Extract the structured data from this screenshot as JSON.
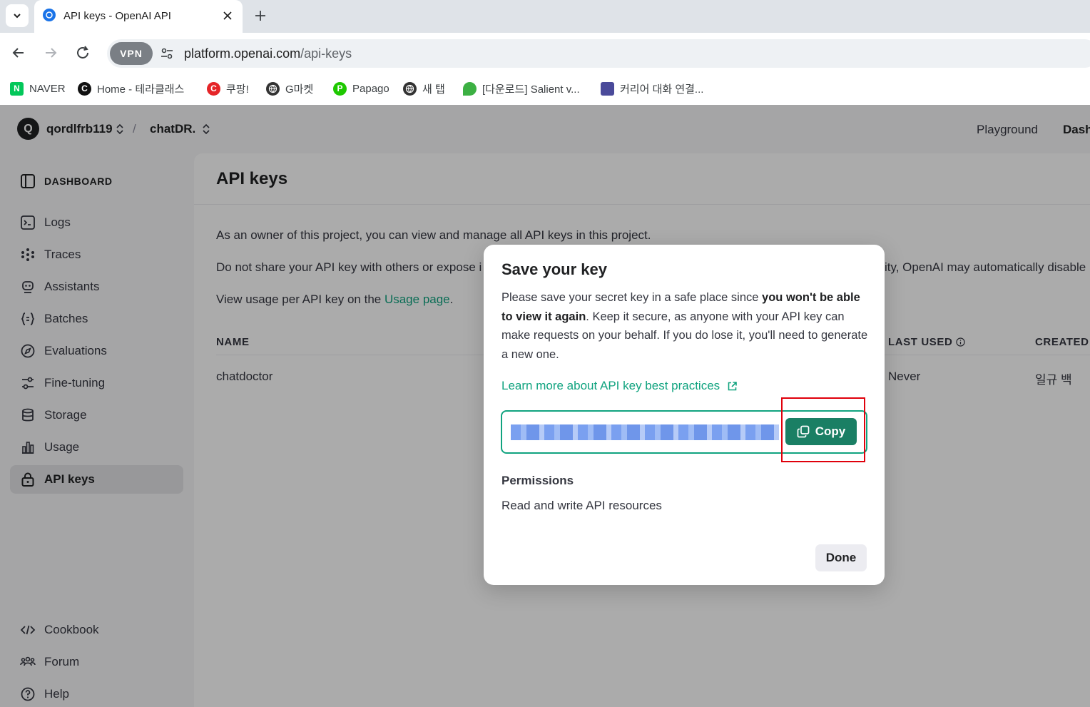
{
  "browser": {
    "tab_title": "API keys - OpenAI API",
    "vpn_label": "VPN",
    "url_host": "platform.openai.com",
    "url_path": "/api-keys",
    "bookmarks": [
      {
        "label": "NAVER",
        "icon": "naver-icon",
        "color": "#03c75a"
      },
      {
        "label": "Home - 테라클래스",
        "icon": "terraclass-icon",
        "color": "#111111"
      },
      {
        "label": "쿠팡!",
        "icon": "coupang-icon",
        "color": "#e52528"
      },
      {
        "label": "G마켓",
        "icon": "globe-icon",
        "color": "#333333"
      },
      {
        "label": "Papago",
        "icon": "papago-icon",
        "color": "#1ec800"
      },
      {
        "label": "새 탭",
        "icon": "globe-icon",
        "color": "#333333"
      },
      {
        "label": "[다운로드] Salient v...",
        "icon": "leaf-icon",
        "color": "#3cb043"
      },
      {
        "label": "커리어 대화 연결...",
        "icon": "cup-icon",
        "color": "#4a4a9a"
      }
    ]
  },
  "header": {
    "org_initial": "Q",
    "org_name": "qordlfrb119",
    "separator": "/",
    "project_name": "chatDR.",
    "links": [
      "Playground",
      "Dash"
    ]
  },
  "sidebar": {
    "section_label": "DASHBOARD",
    "items": [
      {
        "label": "Logs",
        "icon": "terminal-icon"
      },
      {
        "label": "Traces",
        "icon": "traces-icon"
      },
      {
        "label": "Assistants",
        "icon": "robot-icon"
      },
      {
        "label": "Batches",
        "icon": "braces-icon"
      },
      {
        "label": "Evaluations",
        "icon": "compass-icon"
      },
      {
        "label": "Fine-tuning",
        "icon": "sliders-icon"
      },
      {
        "label": "Storage",
        "icon": "database-icon"
      },
      {
        "label": "Usage",
        "icon": "bar-chart-icon"
      },
      {
        "label": "API keys",
        "icon": "lock-icon",
        "active": true
      }
    ],
    "footer_items": [
      {
        "label": "Cookbook",
        "icon": "code-icon"
      },
      {
        "label": "Forum",
        "icon": "people-icon"
      },
      {
        "label": "Help",
        "icon": "help-icon"
      }
    ]
  },
  "main": {
    "title": "API keys",
    "desc_1": "As an owner of this project, you can view and manage all API keys in this project.",
    "desc_2_left": "Do not share your API key with others or expose i",
    "desc_2_right": "ity, OpenAI may automatically disable",
    "desc_3_prefix": "View usage per API key on the ",
    "desc_3_link": "Usage page",
    "desc_3_suffix": ".",
    "columns": {
      "name": "NAME",
      "last_used": "LAST USED",
      "created": "CREATED"
    },
    "rows": [
      {
        "name": "chatdoctor",
        "last_used": "Never",
        "created": "일규 백"
      }
    ]
  },
  "modal": {
    "title": "Save your key",
    "body_1": "Please save your secret key in a safe place since ",
    "body_bold": "you won't be able to view it again",
    "body_2": ". Keep it secure, as anyone with your API key can make requests on your behalf. If you do lose it, you'll need to generate a new one.",
    "learn_more": "Learn more about API key best practices",
    "copy_label": "Copy",
    "permissions_heading": "Permissions",
    "permissions_value": "Read and write API resources",
    "done_label": "Done"
  },
  "colors": {
    "accent": "#10a37f",
    "copy_button": "#1a7f64",
    "highlight_box": "#e0000b"
  }
}
